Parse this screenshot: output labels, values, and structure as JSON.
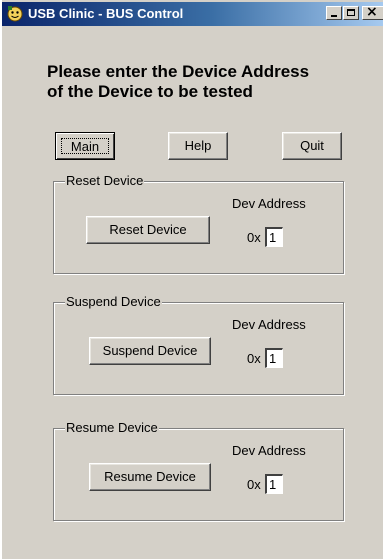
{
  "window": {
    "title": "USB Clinic - BUS Control",
    "controls": {
      "minimize": "_",
      "maximize": "□",
      "close": "×"
    }
  },
  "instructions": "Please enter the Device Address\nof the Device to be tested",
  "toolbar": {
    "main_label": "Main",
    "help_label": "Help",
    "quit_label": "Quit"
  },
  "groups": [
    {
      "title": "Reset Device",
      "button_label": "Reset Device",
      "address_label": "Dev Address",
      "hex_prefix": "0x",
      "address_value": "1"
    },
    {
      "title": "Suspend Device",
      "button_label": "Suspend Device",
      "address_label": "Dev Address",
      "hex_prefix": "0x",
      "address_value": "1"
    },
    {
      "title": "Resume Device",
      "button_label": "Resume Device",
      "address_label": "Dev Address",
      "hex_prefix": "0x",
      "address_value": "1"
    }
  ],
  "colors": {
    "window_face": "#d4d0c8",
    "titlebar_start": "#0a246a",
    "titlebar_end": "#a6caf0",
    "title_text": "#ffffff"
  }
}
